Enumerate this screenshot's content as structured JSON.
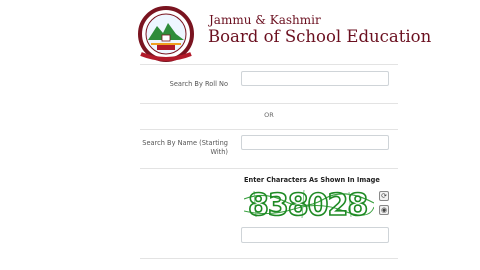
{
  "header": {
    "line1": "Jammu & Kashmir",
    "line2": "Board of School Education"
  },
  "form": {
    "roll_label": "Search By Roll No",
    "or_text": "OR",
    "name_label": "Search By Name (Starting With)",
    "captcha_label": "Enter Characters As Shown In Image",
    "captcha_text": "838028",
    "refresh_icon": "refresh-icon",
    "audio_icon": "audio-icon"
  },
  "colors": {
    "brand": "#6b1020",
    "captcha_green": "#1e8a24"
  }
}
